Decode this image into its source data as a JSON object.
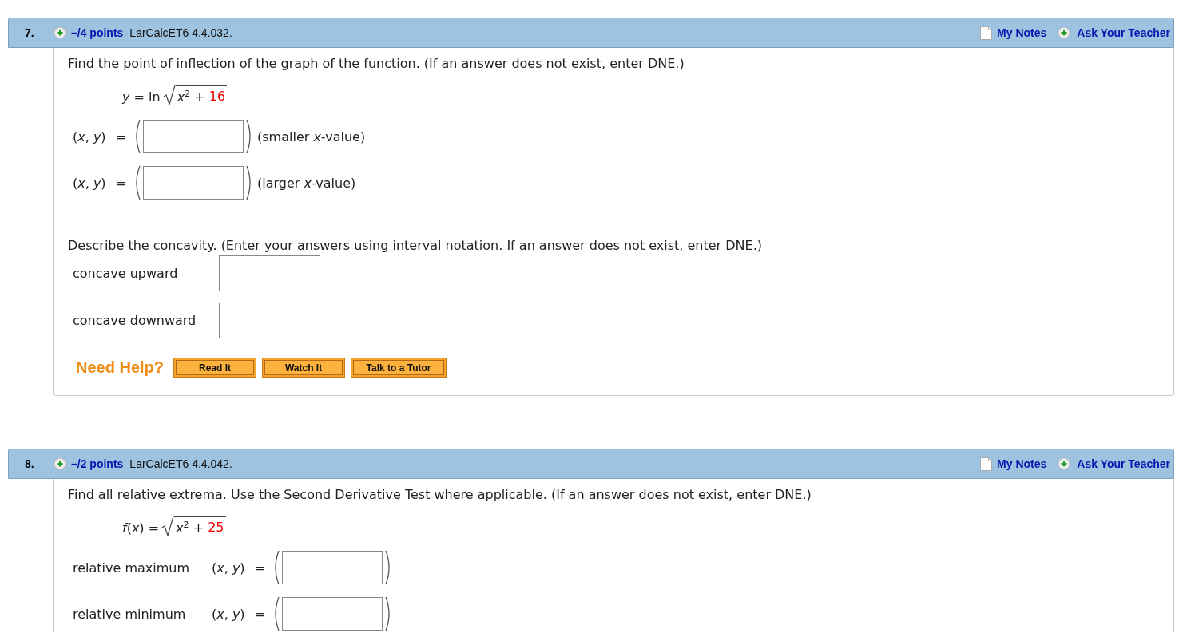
{
  "questions": [
    {
      "number": "7.",
      "points": "–/4 points",
      "code": "LarCalcET6 4.4.032.",
      "notes_link": "My Notes",
      "ask_link": "Ask Your Teacher",
      "parts": [
        {
          "kind": "prompt",
          "text": "Find the point of inflection of the graph of the function. (If an answer does not exist, enter DNE.)"
        },
        {
          "kind": "formula",
          "lhs": "*y* = ln",
          "radicand": "*x*$^{2}$ +",
          "constant": "16"
        },
        {
          "kind": "point",
          "pair": "(*x*, *y*)",
          "equals": "=",
          "note": "(smaller *x*-value)"
        },
        {
          "kind": "point",
          "pair": "(*x*, *y*)",
          "equals": "=",
          "note": "(larger *x*-value)"
        },
        {
          "kind": "prompt",
          "text": "Describe the concavity. (Enter your answers using interval notation. If an answer does not exist, enter DNE.)"
        },
        {
          "kind": "field",
          "label": "concave upward"
        },
        {
          "kind": "field",
          "label": "concave downward"
        },
        {
          "kind": "help",
          "title": "Need Help?",
          "buttons": [
            "Read It",
            "Watch It",
            "Talk to a Tutor"
          ]
        }
      ]
    },
    {
      "number": "8.",
      "points": "–/2 points",
      "code": "LarCalcET6 4.4.042.",
      "notes_link": "My Notes",
      "ask_link": "Ask Your Teacher",
      "parts": [
        {
          "kind": "prompt",
          "text": "Find all relative extrema. Use the Second Derivative Test where applicable. (If an answer does not exist, enter DNE.)"
        },
        {
          "kind": "formula",
          "lhs": "*f*(*x*) =",
          "radicand": "*x*$^{2}$ +",
          "constant": "25"
        },
        {
          "kind": "labeled_point",
          "label": "relative maximum",
          "pair": "(*x*, *y*)",
          "equals": "="
        },
        {
          "kind": "labeled_point",
          "label": "relative minimum",
          "pair": "(*x*, *y*)",
          "equals": "="
        }
      ]
    }
  ]
}
